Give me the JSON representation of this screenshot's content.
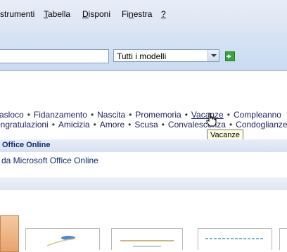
{
  "menu": {
    "items": [
      {
        "pre": "",
        "acc": "",
        "post": "rstrumenti"
      },
      {
        "pre": "",
        "acc": "T",
        "post": "abella"
      },
      {
        "pre": "",
        "acc": "D",
        "post": "isponi"
      },
      {
        "pre": "Fi",
        "acc": "n",
        "post": "estra"
      },
      {
        "pre": "",
        "acc": "?",
        "post": ""
      }
    ]
  },
  "toolbar": {
    "search_value": "",
    "model_select_value": "Tutti i modelli"
  },
  "categories": {
    "row1": [
      "rasloco",
      "Fidanzamento",
      "Nascita",
      "Promemoria",
      "Vacanze",
      "Compleanno"
    ],
    "row2": [
      "ongratulazioni",
      "Amicizia",
      "Amore",
      "Scusa",
      "Convalescenza",
      "Condoglianze"
    ],
    "separator": "•"
  },
  "tooltip": {
    "text": "Vacanze"
  },
  "office_online": {
    "header": "Office Online",
    "link": "da Microsoft Office Online"
  }
}
